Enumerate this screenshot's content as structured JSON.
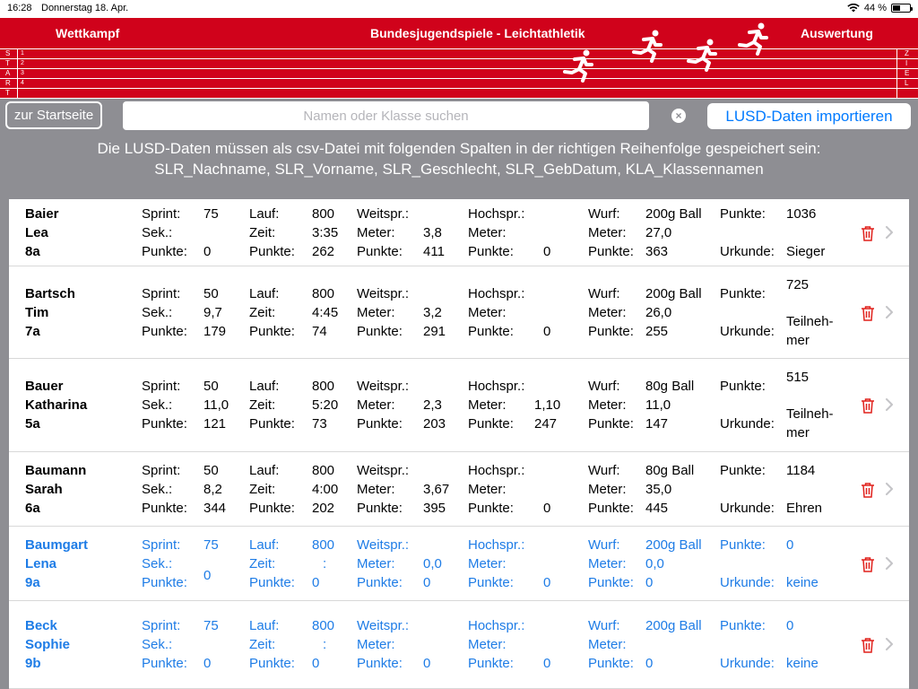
{
  "status": {
    "time": "16:28",
    "date": "Donnerstag 18. Apr.",
    "battery": "44 %"
  },
  "header": {
    "left": "Wettkampf",
    "center": "Bundesjugendspiele - Leichtathletik",
    "right": "Auswertung",
    "start_letters": [
      "S",
      "T",
      "A",
      "R",
      "T"
    ],
    "lane_numbers": [
      "1",
      "2",
      "3",
      "4"
    ],
    "ziel_letters": [
      "Z",
      "I",
      "E",
      "L"
    ]
  },
  "toolbar": {
    "home_label": "zur Startseite",
    "search_placeholder": "Namen oder Klasse suchen",
    "clear_symbol": "×",
    "import_label": "LUSD-Daten importieren"
  },
  "info": {
    "line1": "Die LUSD-Daten müssen als csv-Datei mit folgenden Spalten in der richtigen Reihenfolge gespeichert sein:",
    "line2": "SLR_Nachname, SLR_Vorname, SLR_Geschlecht, SLR_GebDatum, KLA_Klassennamen"
  },
  "labels": {
    "sprint": "Sprint:",
    "sek": "Sek.:",
    "punkte": "Punkte:",
    "lauf": "Lauf:",
    "zeit": "Zeit:",
    "weitspr": "Weitspr.:",
    "meter": "Meter:",
    "hochspr": "Hochspr.:",
    "wurf": "Wurf:",
    "urkunde": "Urkunde:"
  },
  "rows": [
    {
      "last": "Baier",
      "first": "Lea",
      "klass": "8a",
      "sprint": "75",
      "sek": "",
      "sprint_pts": "0",
      "lauf": "800",
      "zeit": "3:35",
      "lauf_pts": "262",
      "weit_m": "3,8",
      "weit_pts": "411",
      "hoch_m": "",
      "hoch_pts": "0",
      "wurf": "200g Ball",
      "wurf_m": "27,0",
      "wurf_pts": "363",
      "total": "1036",
      "urkunde": "Sieger"
    },
    {
      "last": "Bartsch",
      "first": "Tim",
      "klass": "7a",
      "sprint": "50",
      "sek": "9,7",
      "sprint_pts": "179",
      "lauf": "800",
      "zeit": "4:45",
      "lauf_pts": "74",
      "weit_m": "3,2",
      "weit_pts": "291",
      "hoch_m": "",
      "hoch_pts": "0",
      "wurf": "200g Ball",
      "wurf_m": "26,0",
      "wurf_pts": "255",
      "total": "725",
      "urkunde_1": "Teilneh-",
      "urkunde_2": "mer"
    },
    {
      "last": "Bauer",
      "first": "Katharina",
      "klass": "5a",
      "sprint": "50",
      "sek": "11,0",
      "sprint_pts": "121",
      "lauf": "800",
      "zeit": "5:20",
      "lauf_pts": "73",
      "weit_m": "2,3",
      "weit_pts": "203",
      "hoch_m": "1,10",
      "hoch_pts": "247",
      "wurf": "80g Ball",
      "wurf_m": "11,0",
      "wurf_pts": "147",
      "total": "515",
      "urkunde_1": "Teilneh-",
      "urkunde_2": "mer"
    },
    {
      "last": "Baumann",
      "first": "Sarah",
      "klass": "6a",
      "sprint": "50",
      "sek": "8,2",
      "sprint_pts": "344",
      "lauf": "800",
      "zeit": "4:00",
      "lauf_pts": "202",
      "weit_m": "3,67",
      "weit_pts": "395",
      "hoch_m": "",
      "hoch_pts": "0",
      "wurf": "80g Ball",
      "wurf_m": "35,0",
      "wurf_pts": "445",
      "total": "1184",
      "urkunde": "Ehren"
    },
    {
      "last": "Baumgart",
      "first": "Lena",
      "klass": "9a",
      "sprint": "75",
      "sek": "0",
      "sprint_pts": "",
      "lauf": "800",
      "zeit": ":",
      "lauf_pts": "0",
      "weit_m": "0,0",
      "weit_pts": "0",
      "hoch_m": "",
      "hoch_pts": "0",
      "wurf": "200g Ball",
      "wurf_m": "0,0",
      "wurf_pts": "0",
      "total": "0",
      "urkunde": "keine"
    },
    {
      "last": "Beck",
      "first": "Sophie",
      "klass": "9b",
      "sprint": "75",
      "sek": "",
      "sprint_pts": "0",
      "lauf": "800",
      "zeit": ":",
      "lauf_pts": "0",
      "weit_m": "",
      "weit_pts": "0",
      "hoch_m": "",
      "hoch_pts": "0",
      "wurf": "200g Ball",
      "wurf_m": "",
      "wurf_pts": "0",
      "total": "0",
      "urkunde": "keine"
    }
  ],
  "colors": {
    "banner": "#d0021b",
    "background": "#8e8e93",
    "accent": "#1e7ce6",
    "trash": "#e0201b"
  },
  "icons": {
    "trash": "trash-icon",
    "chevron": "chevron-right-icon",
    "runner": "runner-icon",
    "wifi": "wifi-icon",
    "battery": "battery-icon"
  }
}
